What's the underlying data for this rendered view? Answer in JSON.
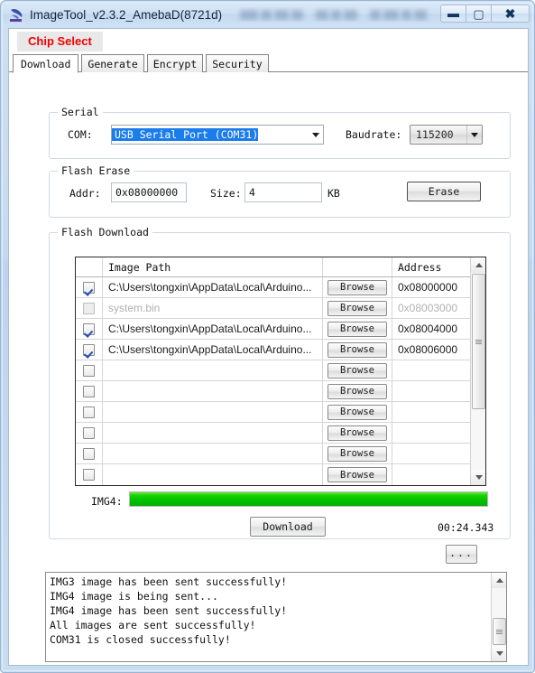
{
  "window": {
    "title": "ImageTool_v2.3.2_AmebaD(8721d)",
    "icon": "app-icon",
    "buttons": {
      "minimize": "–",
      "maximize": "□",
      "close": "✕"
    }
  },
  "menubar": {
    "chip_select": "Chip Select",
    "chip_select_color": "#f40000"
  },
  "tabs": [
    {
      "label": "Download",
      "active": true
    },
    {
      "label": "Generate",
      "active": false
    },
    {
      "label": "Encrypt",
      "active": false
    },
    {
      "label": "Security",
      "active": false
    }
  ],
  "serial": {
    "title": "Serial",
    "com_label": "COM:",
    "com_value": "USB Serial Port (COM31)",
    "baudrate_label": "Baudrate:",
    "baudrate_value": "115200"
  },
  "flash_erase": {
    "title": "Flash Erase",
    "addr_label": "Addr:",
    "addr_value": "0x08000000",
    "size_label": "Size:",
    "size_value": "4",
    "unit_label": "KB",
    "erase_button": "Erase"
  },
  "flash_download": {
    "title": "Flash Download",
    "columns": {
      "check": "",
      "image_path": "Image Path",
      "browse": "",
      "address": "Address"
    },
    "browse_label": "Browse",
    "rows": [
      {
        "checked": true,
        "disabled": false,
        "path": "C:\\Users\\tongxin\\AppData\\Local\\Arduino...",
        "address": "0x08000000"
      },
      {
        "checked": false,
        "disabled": true,
        "path": "system.bin",
        "address": "0x08003000"
      },
      {
        "checked": true,
        "disabled": false,
        "path": "C:\\Users\\tongxin\\AppData\\Local\\Arduino...",
        "address": "0x08004000"
      },
      {
        "checked": true,
        "disabled": false,
        "path": "C:\\Users\\tongxin\\AppData\\Local\\Arduino...",
        "address": "0x08006000"
      },
      {
        "checked": false,
        "disabled": false,
        "path": "",
        "address": ""
      },
      {
        "checked": false,
        "disabled": false,
        "path": "",
        "address": ""
      },
      {
        "checked": false,
        "disabled": false,
        "path": "",
        "address": ""
      },
      {
        "checked": false,
        "disabled": false,
        "path": "",
        "address": ""
      },
      {
        "checked": false,
        "disabled": false,
        "path": "",
        "address": ""
      },
      {
        "checked": false,
        "disabled": false,
        "path": "",
        "address": ""
      }
    ],
    "progress_label": "IMG4:",
    "progress_percent": 100,
    "progress_color": "#00c000",
    "download_button": "Download",
    "elapsed_time": "00:24.343"
  },
  "more_button": {
    "label": "..."
  },
  "log": {
    "lines": [
      "IMG3 image has been sent successfully!",
      "IMG4 image is being sent...",
      "IMG4 image has been sent successfully!",
      "All images are sent successfully!",
      "COM31 is closed successfully!"
    ],
    "text": "IMG3 image has been sent successfully!\nIMG4 image is being sent...\nIMG4 image has been sent successfully!\nAll images are sent successfully!\nCOM31 is closed successfully!"
  }
}
